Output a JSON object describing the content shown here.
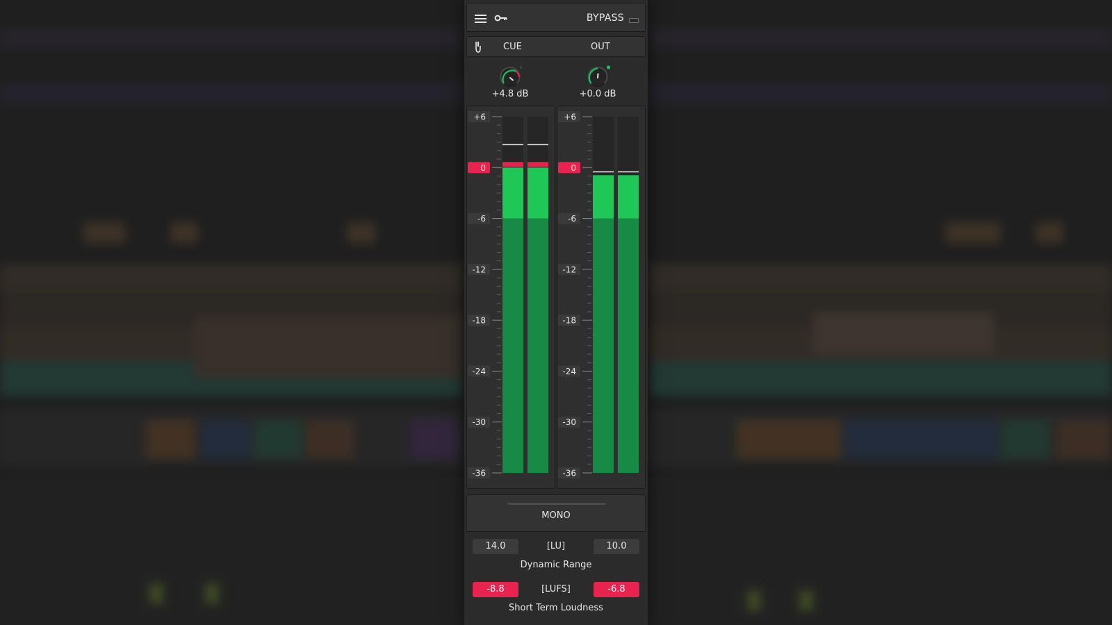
{
  "colors": {
    "accent_red": "#e8234d",
    "meter_green_bright": "#1fc757",
    "meter_green_dark": "#178a46",
    "panel_bg": "#2b2b2b",
    "knob_green": "#18c45a"
  },
  "header": {
    "menu_icon": "hamburger-icon",
    "key_icon": "key-icon",
    "bypass_label": "BYPASS"
  },
  "cue_bar": {
    "cue_icon": "cue-headphone-icon",
    "cue_label": "CUE",
    "out_label": "OUT"
  },
  "knobs": {
    "cue": {
      "value_label": "+4.8 dB",
      "value_db": 4.8
    },
    "out": {
      "value_label": "+0.0 dB",
      "value_db": 0.0
    }
  },
  "meter_scale": {
    "ticks": [
      "+6",
      "0",
      "-6",
      "-12",
      "-18",
      "-24",
      "-30",
      "-36"
    ],
    "tick_values": [
      6,
      0,
      -6,
      -12,
      -18,
      -24,
      -30,
      -36
    ],
    "highlighted_tick": "0",
    "range_db": [
      -36,
      6
    ]
  },
  "meters": {
    "cue": {
      "levels_db": [
        0,
        0
      ],
      "peak_hold_db": [
        2.7,
        2.7
      ],
      "clip": true
    },
    "out": {
      "levels_db": [
        -0.9,
        -0.9
      ],
      "peak_hold_db": [
        -0.5,
        -0.5
      ],
      "clip": false
    }
  },
  "mono": {
    "label": "MONO"
  },
  "dynamic_range": {
    "left_value": "14.0",
    "unit": "[LU]",
    "right_value": "10.0",
    "title": "Dynamic Range"
  },
  "short_term_loudness": {
    "left_value": "-8.8",
    "unit": "[LUFS]",
    "right_value": "-6.8",
    "title": "Short Term Loudness"
  }
}
